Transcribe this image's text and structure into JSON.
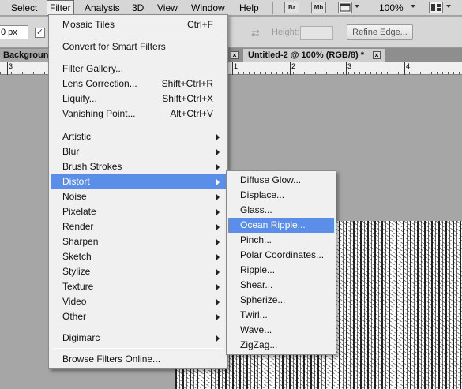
{
  "menubar": {
    "items": [
      "Select",
      "Filter",
      "Analysis",
      "3D",
      "View",
      "Window",
      "Help"
    ],
    "icons": [
      "Br",
      "Mb"
    ],
    "zoom": "100%"
  },
  "options": {
    "feather_value": "0 px",
    "height_label": "Height:",
    "refine_edge_label": "Refine Edge..."
  },
  "tabs": {
    "background_tab": "Background",
    "active_tab": "Untitled-2 @ 100% (RGB/8) *"
  },
  "ruler": {
    "numbers": [
      "3",
      "1",
      "2",
      "3",
      "4"
    ]
  },
  "filter_menu": {
    "top": [
      {
        "label": "Mosaic Tiles",
        "shortcut": "Ctrl+F"
      }
    ],
    "smart": [
      {
        "label": "Convert for Smart Filters"
      }
    ],
    "gallery": [
      {
        "label": "Filter Gallery..."
      },
      {
        "label": "Lens Correction...",
        "shortcut": "Shift+Ctrl+R"
      },
      {
        "label": "Liquify...",
        "shortcut": "Shift+Ctrl+X"
      },
      {
        "label": "Vanishing Point...",
        "shortcut": "Alt+Ctrl+V"
      }
    ],
    "groups": [
      "Artistic",
      "Blur",
      "Brush Strokes",
      "Distort",
      "Noise",
      "Pixelate",
      "Render",
      "Sharpen",
      "Sketch",
      "Stylize",
      "Texture",
      "Video",
      "Other"
    ],
    "highlighted_group": "Distort",
    "plugins": [
      "Digimarc"
    ],
    "online": "Browse Filters Online..."
  },
  "distort_menu": {
    "items": [
      "Diffuse Glow...",
      "Displace...",
      "Glass...",
      "Ocean Ripple...",
      "Pinch...",
      "Polar Coordinates...",
      "Ripple...",
      "Shear...",
      "Spherize...",
      "Twirl...",
      "Wave...",
      "ZigZag..."
    ],
    "highlighted": "Ocean Ripple..."
  },
  "colors": {
    "highlight": "#5a8ee8",
    "menu_bg": "#f0f0f0",
    "workspace": "#a6a6a6"
  }
}
